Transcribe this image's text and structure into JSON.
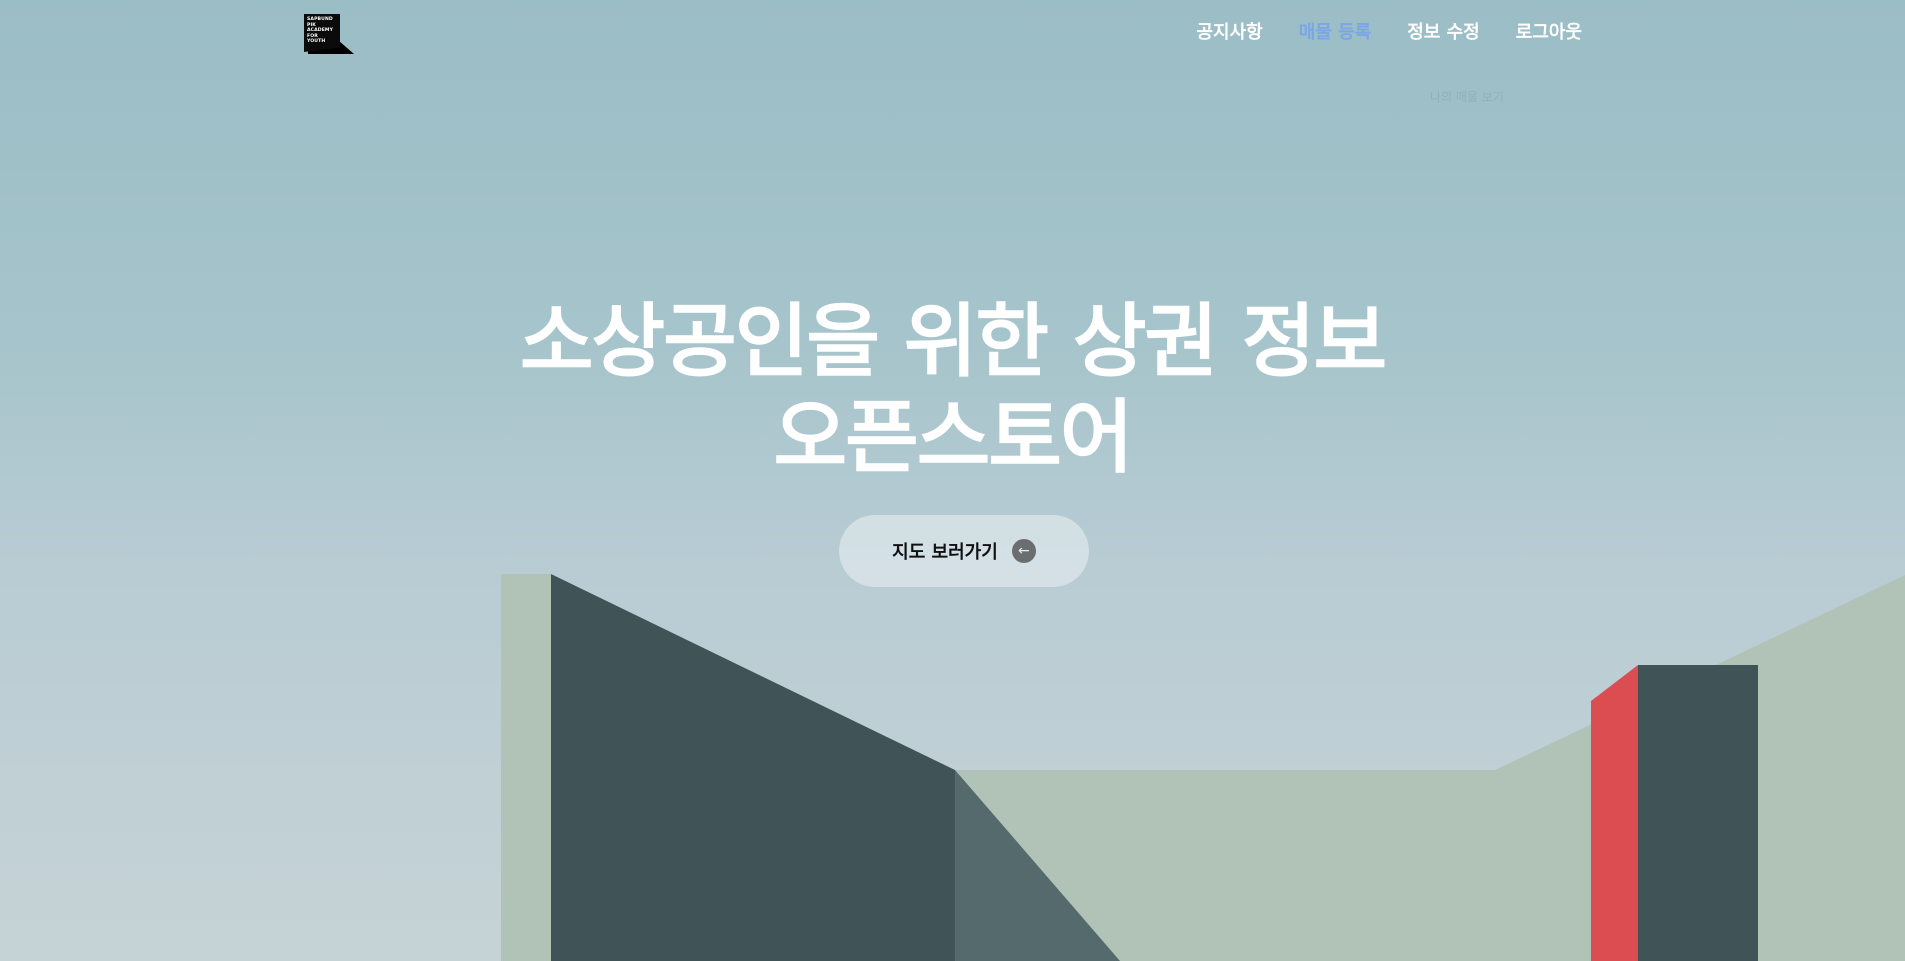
{
  "header": {
    "logo_text": "SAPBUND\nPIK\nACADEMY\nFOR\nYOUTH",
    "nav": [
      {
        "label": "공지사항",
        "active": false
      },
      {
        "label": "매물 등록",
        "active": true
      },
      {
        "label": "정보 수정",
        "active": false
      },
      {
        "label": "로그아웃",
        "active": false
      }
    ],
    "submenu_hint": "나의 매물 보기"
  },
  "hero": {
    "title_line1": "소상공인을 위한 상권 정보",
    "title_line2": "오픈스토어",
    "button_label": "지도 보러가기",
    "button_icon": "arrow-left-icon"
  },
  "colors": {
    "sky_top": "#9bbdc6",
    "sky_bottom": "#c6d3d6",
    "building_dark": "#405457",
    "building_mid": "#546a6c",
    "ground_sage": "#b1c3b7",
    "accent_red": "#dc4d51",
    "nav_active": "#7aa6e6"
  }
}
